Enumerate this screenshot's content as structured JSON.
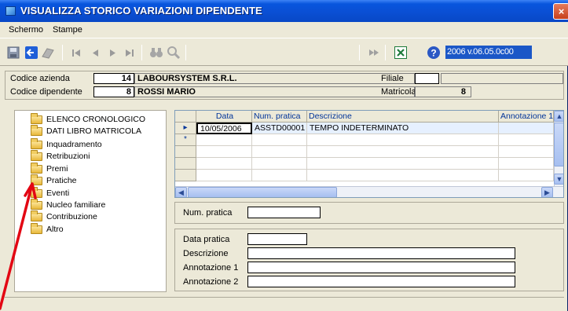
{
  "window": {
    "title": "VISUALIZZA STORICO VARIAZIONI DIPENDENTE",
    "close_label": "×"
  },
  "menu": {
    "items": [
      "Schermo",
      "Stampe"
    ]
  },
  "toolbar": {
    "version_text": "2006 v.06.05.0c00",
    "icons": [
      "save-icon",
      "exit-icon",
      "edit-icon",
      "first-record-icon",
      "previous-record-icon",
      "next-record-icon",
      "last-record-icon",
      "binoculars-icon",
      "magnifier-icon",
      "export-icon",
      "excel-icon",
      "help-icon"
    ]
  },
  "header": {
    "codice_azienda_label": "Codice azienda",
    "codice_azienda_value": "14",
    "azienda_name": "LABOURSYSTEM S.R.L.",
    "codice_dipendente_label": "Codice dipendente",
    "codice_dipendente_value": "8",
    "dipendente_name": "ROSSI MARIO",
    "filiale_label": "Filiale",
    "filiale_value": "",
    "matricola_label": "Matricola",
    "matricola_value": "8"
  },
  "tree": {
    "items": [
      "ELENCO CRONOLOGICO",
      "DATI LIBRO MATRICOLA",
      "Inquadramento",
      "Retribuzioni",
      "Premi",
      "Pratiche",
      "Eventi",
      "Nucleo familiare",
      "Contribuzione",
      "Altro"
    ],
    "selected": "Pratiche"
  },
  "grid": {
    "columns": [
      "Data",
      "Num. pratica",
      "Descrizione",
      "Annotazione 1"
    ],
    "rows": [
      {
        "marker": "▸",
        "data": "10/05/2006",
        "num_pratica": "ASSTD00001",
        "descrizione": "TEMPO INDETERMINATO",
        "annotazione1": ""
      },
      {
        "marker": "*",
        "data": "",
        "num_pratica": "",
        "descrizione": "",
        "annotazione1": ""
      }
    ],
    "scroll_up": "▲",
    "scroll_down": "▼",
    "scroll_left": "◀",
    "scroll_right": "▶"
  },
  "form": {
    "num_pratica_label": "Num. pratica",
    "num_pratica_value": "",
    "data_pratica_label": "Data pratica",
    "data_pratica_value": "",
    "descrizione_label": "Descrizione",
    "descrizione_value": "",
    "annotazione1_label": "Annotazione 1",
    "annotazione1_value": "",
    "annotazione2_label": "Annotazione 2",
    "annotazione2_value": ""
  },
  "colors": {
    "titlebar": "#0a4fd4",
    "window_bg": "#ece9d8",
    "version_bg": "#1b57c7",
    "pointer": "#e30613"
  }
}
